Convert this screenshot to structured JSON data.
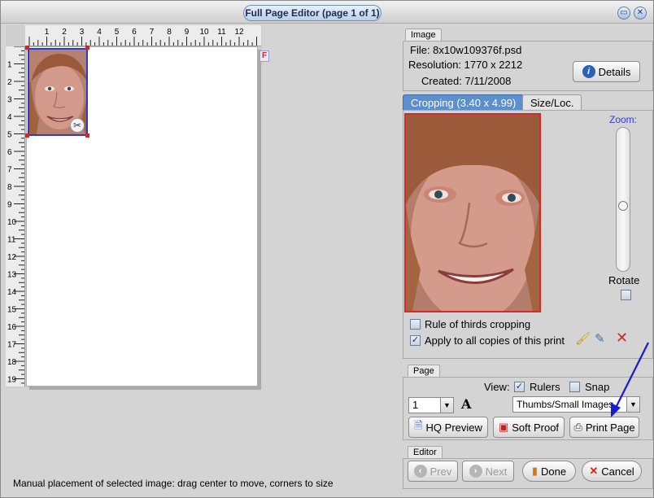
{
  "window": {
    "title": "Full Page Editor (page 1 of 1)",
    "minimize_icon": "minimize-icon",
    "close_icon": "close-icon"
  },
  "rulers": {
    "top_ticks": [
      "1",
      "2",
      "3",
      "4",
      "5",
      "6",
      "7",
      "8",
      "9",
      "10",
      "11",
      "12"
    ],
    "left_ticks": [
      "1",
      "2",
      "3",
      "4",
      "5",
      "6",
      "7",
      "8",
      "9",
      "10",
      "11",
      "12",
      "13",
      "14",
      "15",
      "16",
      "17",
      "18",
      "19"
    ]
  },
  "page_marker": "F",
  "status": "Manual placement of selected image: drag center to move, corners to size",
  "image_info": {
    "group_label": "Image",
    "file": "File: 8x10w109376f.psd",
    "resolution": "Resolution: 1770 x 2212",
    "created": "Created: 7/11/2008",
    "details_label": "Details"
  },
  "tabs": [
    {
      "label": "Cropping (3.40 x 4.99)",
      "active": true
    },
    {
      "label": "Size/Loc.",
      "active": false
    }
  ],
  "crop": {
    "zoom_label": "Zoom:",
    "zoom_level": 0.55,
    "rotate_label": "Rotate",
    "rule_of_thirds": {
      "label": "Rule of thirds cropping",
      "checked": false
    },
    "apply_all": {
      "label": "Apply to all copies of this print",
      "checked": true
    }
  },
  "page_group": {
    "group_label": "Page",
    "view_label": "View:",
    "rulers": {
      "label": "Rulers",
      "checked": true
    },
    "snap": {
      "label": "Snap",
      "checked": false
    },
    "copies_value": "1",
    "text_tool_glyph": "A",
    "quality_value": "Thumbs/Small Images",
    "hq_preview_label": "HQ Preview",
    "soft_proof_label": "Soft Proof",
    "print_page_label": "Print Page"
  },
  "editor_group": {
    "group_label": "Editor",
    "prev_label": "Prev",
    "next_label": "Next",
    "done_label": "Done",
    "cancel_label": "Cancel"
  },
  "colors": {
    "accent_tab": "#5b8fd0",
    "crop_border": "#d42a2a",
    "selection_border": "#2c3cc8",
    "annotation_arrow": "#1a1ad0"
  }
}
